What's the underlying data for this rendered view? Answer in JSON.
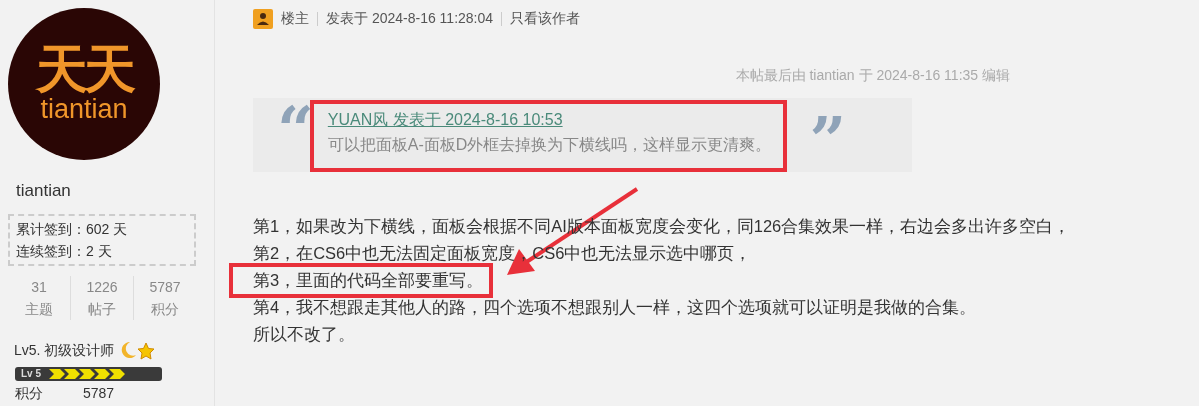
{
  "user": {
    "logo_chars": "天天",
    "logo_name": "tiantian",
    "name": "tiantian",
    "signin": [
      {
        "label": "累计签到：",
        "value": "602 天"
      },
      {
        "label": "连续签到：",
        "value": "2 天"
      }
    ],
    "stats": [
      {
        "value": "31",
        "label": "主题"
      },
      {
        "value": "1226",
        "label": "帖子"
      },
      {
        "value": "5787",
        "label": "积分"
      }
    ],
    "rank": "Lv5. 初级设计师",
    "level_badge": "Lv 5",
    "points": {
      "label": "积分",
      "value": "5787"
    }
  },
  "post": {
    "author_tag": "楼主",
    "posted": "发表于 2024-8-16 11:28:04",
    "only_author": "只看该作者",
    "edit_note": "本帖最后由 tiantian 于 2024-8-16 11:35 编辑",
    "quote": {
      "open_mark": "“",
      "close_mark": "”",
      "source": "YUAN风 发表于 2024-8-16 10:53",
      "text": "可以把面板A-面板D外框去掉换为下横线吗，这样显示更清爽。",
      "highlighted": true
    },
    "lines": [
      {
        "text": "第1，如果改为下横线，面板会根据不同AI版本面板宽度会变化，同126合集效果一样，右边会多出许多空白，",
        "highlighted": false
      },
      {
        "text": "第2，在CS6中也无法固定面板宽度，CS6中也无法显示选中哪页，",
        "highlighted": false
      },
      {
        "text": "第3，里面的代码全部要重写。",
        "highlighted": true
      },
      {
        "text": "第4，我不想跟走其他人的路，四个选项不想跟别人一样，这四个选项就可以证明是我做的合集。",
        "highlighted": false
      },
      {
        "text": "所以不改了。",
        "highlighted": false
      }
    ]
  }
}
